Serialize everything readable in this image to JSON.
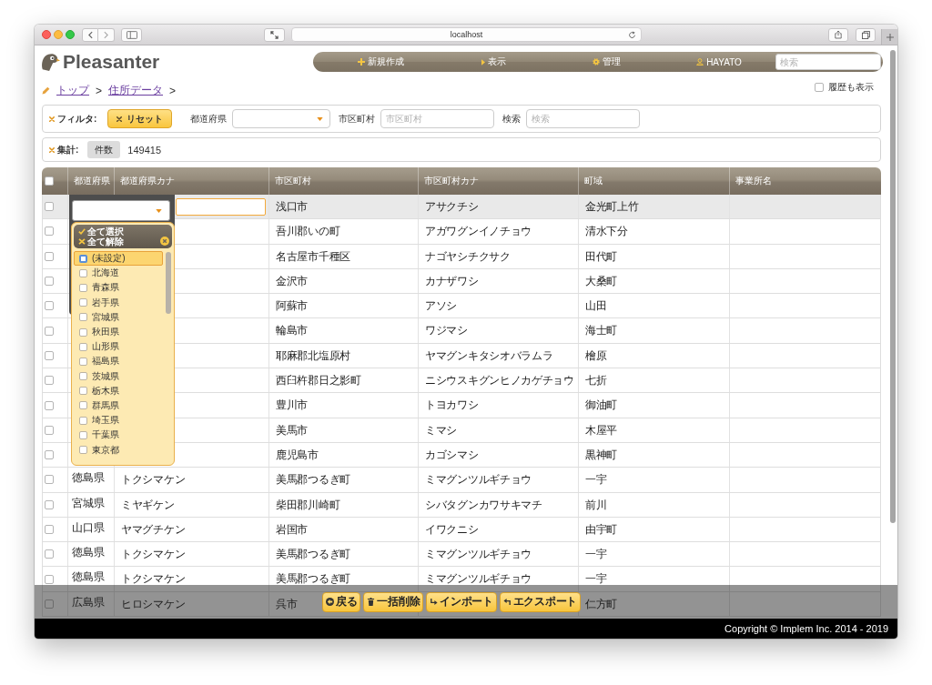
{
  "browser": {
    "url": "localhost"
  },
  "header": {
    "logo": "Pleasanter",
    "nav": [
      {
        "kind": "new",
        "label": "新規作成"
      },
      {
        "kind": "view",
        "label": "表示"
      },
      {
        "kind": "manage",
        "label": "管理"
      },
      {
        "kind": "user",
        "label": "HAYATO"
      }
    ],
    "search": {
      "placeholder": "検索"
    }
  },
  "breadcrumb": [
    {
      "label": "トップ",
      "separator": ">"
    },
    {
      "label": "住所データ",
      "separator": ">"
    }
  ],
  "history": {
    "label": "履歴も表示",
    "checked": false
  },
  "filter": {
    "title": "フィルタ:",
    "reset": "リセット",
    "fields": [
      {
        "kind": "select",
        "label": "都道府県"
      },
      {
        "kind": "text",
        "label": "市区町村",
        "placeholder": "市区町村"
      },
      {
        "kind": "text",
        "label": "検索",
        "placeholder": "検索"
      }
    ]
  },
  "summary": {
    "title": "集計:",
    "tag": "件数",
    "value": "149415"
  },
  "table": {
    "all_checked": false,
    "columns": [
      "都道府県",
      "都道府県カナ",
      "市区町村",
      "市区町村カナ",
      "町域",
      "事業所名"
    ],
    "rows": [
      {
        "checked": false,
        "hovered": true,
        "cells": [
          null,
          null,
          "浅口市",
          "アサクチシ",
          "金光町上竹"
        ]
      },
      {
        "checked": false,
        "hovered": false,
        "cells": [
          null,
          null,
          "吾川郡いの町",
          "アガワグンイノチョウ",
          "清水下分"
        ]
      },
      {
        "checked": false,
        "hovered": false,
        "cells": [
          null,
          null,
          "名古屋市千種区",
          "ナゴヤシチクサク",
          "田代町"
        ]
      },
      {
        "checked": false,
        "hovered": false,
        "cells": [
          null,
          null,
          "金沢市",
          "カナザワシ",
          "大桑町"
        ]
      },
      {
        "checked": false,
        "hovered": false,
        "cells": [
          null,
          null,
          "阿蘇市",
          "アソシ",
          "山田"
        ]
      },
      {
        "checked": false,
        "hovered": false,
        "cells": [
          null,
          null,
          "輪島市",
          "ワジマシ",
          "海士町"
        ]
      },
      {
        "checked": false,
        "hovered": false,
        "cells": [
          null,
          null,
          "耶麻郡北塩原村",
          "ヤマグンキタシオバラムラ",
          "檜原"
        ]
      },
      {
        "checked": false,
        "hovered": false,
        "cells": [
          null,
          null,
          "西臼杵郡日之影町",
          "ニシウスキグンヒノカゲチョウ",
          "七折"
        ]
      },
      {
        "checked": false,
        "hovered": false,
        "cells": [
          null,
          null,
          "豊川市",
          "トヨカワシ",
          "御油町"
        ]
      },
      {
        "checked": false,
        "hovered": false,
        "cells": [
          null,
          null,
          "美馬市",
          "ミマシ",
          "木屋平"
        ]
      },
      {
        "checked": false,
        "hovered": false,
        "cells": [
          null,
          null,
          "鹿児島市",
          "カゴシマシ",
          "黒神町"
        ]
      },
      {
        "checked": false,
        "hovered": false,
        "cells": [
          "徳島県",
          "トクシマケン",
          "美馬郡つるぎ町",
          "ミマグンツルギチョウ",
          "一宇"
        ]
      },
      {
        "checked": false,
        "hovered": false,
        "cells": [
          "宮城県",
          "ミヤギケン",
          "柴田郡川崎町",
          "シバタグンカワサキマチ",
          "前川"
        ]
      },
      {
        "checked": false,
        "hovered": false,
        "cells": [
          "山口県",
          "ヤマグチケン",
          "岩国市",
          "イワクニシ",
          "由宇町"
        ]
      },
      {
        "checked": false,
        "hovered": false,
        "cells": [
          "徳島県",
          "トクシマケン",
          "美馬郡つるぎ町",
          "ミマグンツルギチョウ",
          "一宇"
        ]
      },
      {
        "checked": false,
        "hovered": false,
        "cells": [
          "徳島県",
          "トクシマケン",
          "美馬郡つるぎ町",
          "ミマグンツルギチョウ",
          "一宇"
        ]
      },
      {
        "checked": false,
        "hovered": false,
        "cells": [
          "広島県",
          "ヒロシマケン",
          "呉市",
          null,
          "仁方町"
        ]
      }
    ]
  },
  "dropdown": {
    "select_all": "全て選択",
    "deselect_all": "全て解除",
    "options": [
      {
        "label": "(未設定)",
        "checked": false,
        "hovered": true
      },
      {
        "label": "北海道",
        "checked": false,
        "hovered": false
      },
      {
        "label": "青森県",
        "checked": false,
        "hovered": false
      },
      {
        "label": "岩手県",
        "checked": false,
        "hovered": false
      },
      {
        "label": "宮城県",
        "checked": false,
        "hovered": false
      },
      {
        "label": "秋田県",
        "checked": false,
        "hovered": false
      },
      {
        "label": "山形県",
        "checked": false,
        "hovered": false
      },
      {
        "label": "福島県",
        "checked": false,
        "hovered": false
      },
      {
        "label": "茨城県",
        "checked": false,
        "hovered": false
      },
      {
        "label": "栃木県",
        "checked": false,
        "hovered": false
      },
      {
        "label": "群馬県",
        "checked": false,
        "hovered": false
      },
      {
        "label": "埼玉県",
        "checked": false,
        "hovered": false
      },
      {
        "label": "千葉県",
        "checked": false,
        "hovered": false
      },
      {
        "label": "東京都",
        "checked": false,
        "hovered": false
      }
    ]
  },
  "actions": [
    {
      "kind": "back",
      "label": "戻る"
    },
    {
      "kind": "delete",
      "label": "一括削除"
    },
    {
      "kind": "import",
      "label": "インポート"
    },
    {
      "kind": "export",
      "label": "エクスポート"
    }
  ],
  "footer": {
    "copyright": "Copyright © Implem Inc. 2014 - 2019"
  }
}
